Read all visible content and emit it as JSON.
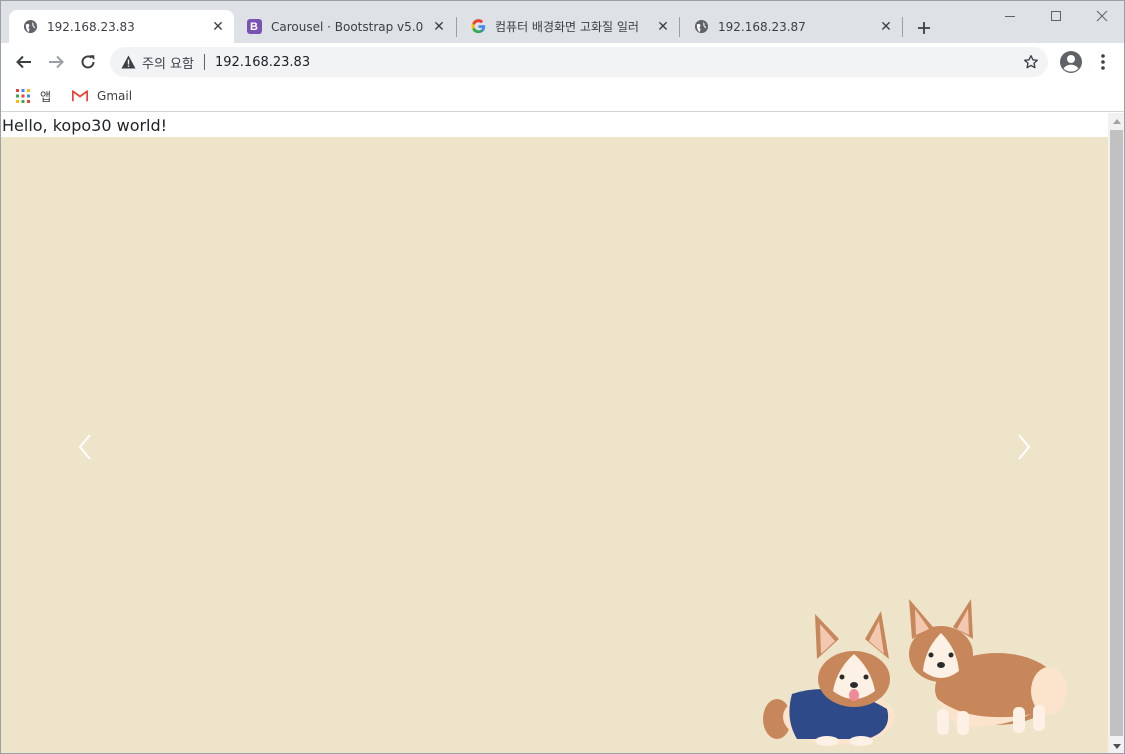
{
  "browser": {
    "tabs": [
      {
        "title": "192.168.23.83",
        "favicon": "globe-icon",
        "active": true
      },
      {
        "title": "Carousel · Bootstrap v5.0",
        "favicon": "bootstrap-icon",
        "favicon_letter": "B",
        "active": false
      },
      {
        "title": "컴퓨터 배경화면 고화질 일러",
        "favicon": "google-icon",
        "active": false
      },
      {
        "title": "192.168.23.87",
        "favicon": "globe-icon",
        "active": false
      }
    ],
    "close_glyph": "✕",
    "address_bar": {
      "security_label": "주의 요함",
      "url": "192.168.23.83"
    },
    "bookmarks": [
      {
        "label": "앱",
        "icon": "apps-grid-icon"
      },
      {
        "label": "Gmail",
        "icon": "gmail-icon"
      }
    ]
  },
  "page": {
    "greeting": "Hello, kopo30 world!",
    "carousel": {
      "background_color": "#ede4c9",
      "image": "two-corgis-illustration"
    }
  },
  "colors": {
    "tabstrip": "#dee1e6",
    "omnibox": "#f1f3f4",
    "bootstrap_purple": "#7952b3",
    "text_dark": "#3c4043"
  }
}
